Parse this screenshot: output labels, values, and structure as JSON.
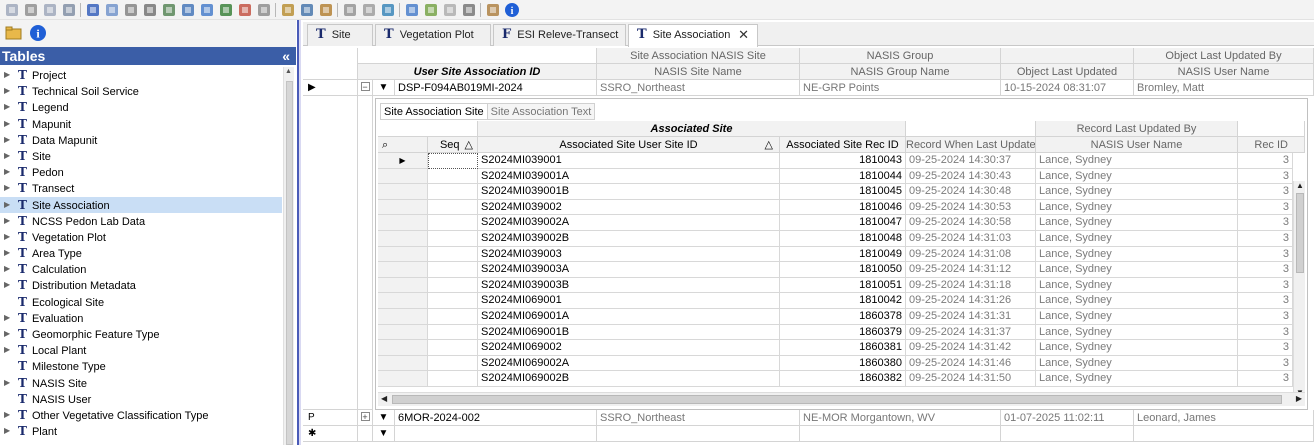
{
  "toolbar": {
    "buttons": [
      "copy-icon",
      "cut-icon",
      "paste-icon",
      "undo-icon",
      "grid-icon",
      "filter-icon",
      "tools-icon",
      "wizard-icon",
      "report-icon",
      "export-icon",
      "window-icon",
      "tree-icon",
      "gear-icon",
      "settings-icon",
      "db-icon",
      "edit-icon",
      "db2-icon",
      "shuffle-icon",
      "sort-icon",
      "refresh-icon",
      "upload-icon",
      "export2-icon",
      "calc-icon",
      "query-icon",
      "help-icon",
      "info-icon"
    ]
  },
  "left_panel": {
    "title": "Tables",
    "collapse_glyph": "«",
    "items": [
      {
        "label": "Project",
        "expandable": true
      },
      {
        "label": "Technical Soil Service",
        "expandable": true
      },
      {
        "label": "Legend",
        "expandable": true
      },
      {
        "label": "Mapunit",
        "expandable": true
      },
      {
        "label": "Data Mapunit",
        "expandable": true
      },
      {
        "label": "Site",
        "expandable": true
      },
      {
        "label": "Pedon",
        "expandable": true
      },
      {
        "label": "Transect",
        "expandable": true
      },
      {
        "label": "Site Association",
        "expandable": true,
        "selected": true
      },
      {
        "label": "NCSS Pedon Lab Data",
        "expandable": true
      },
      {
        "label": "Vegetation Plot",
        "expandable": true
      },
      {
        "label": "Area Type",
        "expandable": true
      },
      {
        "label": "Calculation",
        "expandable": true
      },
      {
        "label": "Distribution Metadata",
        "expandable": true
      },
      {
        "label": "Ecological Site",
        "expandable": false
      },
      {
        "label": "Evaluation",
        "expandable": true
      },
      {
        "label": "Geomorphic Feature Type",
        "expandable": true
      },
      {
        "label": "Local Plant",
        "expandable": true
      },
      {
        "label": "Milestone Type",
        "expandable": false
      },
      {
        "label": "NASIS Site",
        "expandable": true
      },
      {
        "label": "NASIS User",
        "expandable": false
      },
      {
        "label": "Other Vegetative Classification Type",
        "expandable": true
      },
      {
        "label": "Plant",
        "expandable": true
      }
    ]
  },
  "tabs": [
    {
      "icon": "T",
      "label": "Site",
      "active": false
    },
    {
      "icon": "T",
      "label": "Vegetation Plot",
      "active": false
    },
    {
      "icon": "F",
      "label": "ESI Releve-Transect",
      "active": false
    },
    {
      "icon": "T",
      "label": "Site Association",
      "active": true,
      "close": "✕"
    }
  ],
  "outer_grid": {
    "header_row1": [
      "Site Association NASIS Site",
      "NASIS Group",
      "",
      "Object Last Updated By"
    ],
    "header_row2": [
      "User Site Association ID",
      "NASIS Site Name",
      "NASIS Group Name",
      "Object Last Updated",
      "NASIS User Name"
    ],
    "rows": [
      {
        "marker": "▶",
        "expander": "−",
        "caret": "▼",
        "id": "DSP-F094AB019MI-2024",
        "site_name": "SSRO_Northeast",
        "group_name": "NE-GRP Points",
        "last_updated": "10-15-2024 08:31:07",
        "user": "Bromley, Matt"
      },
      {
        "marker": "P",
        "expander": "+",
        "caret": "▼",
        "id": "6MOR-2024-002",
        "site_name": "SSRO_Northeast",
        "group_name": "NE-MOR Morgantown, WV",
        "last_updated": "01-07-2025 11:02:11",
        "user": "Leonard, James"
      },
      {
        "marker": "✱",
        "expander": "",
        "caret": "▼",
        "id": "",
        "site_name": "",
        "group_name": "",
        "last_updated": "",
        "user": ""
      }
    ]
  },
  "sub_panel": {
    "tabs": [
      "Site Association Site",
      "Site Association Text"
    ],
    "group_header": "Associated Site",
    "group_header2": "Record Last Updated By",
    "columns": [
      "Seq",
      "Associated Site User Site ID",
      "Associated Site Rec ID",
      "Record When Last Updated",
      "NASIS User Name",
      "Rec ID"
    ],
    "search_glyph": "⌕",
    "sort_glyph": "△",
    "rows": [
      {
        "site": "S2024MI039001",
        "rec": "1810043",
        "when": "09-25-2024 14:30:37",
        "user": "Lance, Sydney",
        "rid": "3"
      },
      {
        "site": "S2024MI039001A",
        "rec": "1810044",
        "when": "09-25-2024 14:30:43",
        "user": "Lance, Sydney",
        "rid": "3"
      },
      {
        "site": "S2024MI039001B",
        "rec": "1810045",
        "when": "09-25-2024 14:30:48",
        "user": "Lance, Sydney",
        "rid": "3"
      },
      {
        "site": "S2024MI039002",
        "rec": "1810046",
        "when": "09-25-2024 14:30:53",
        "user": "Lance, Sydney",
        "rid": "3"
      },
      {
        "site": "S2024MI039002A",
        "rec": "1810047",
        "when": "09-25-2024 14:30:58",
        "user": "Lance, Sydney",
        "rid": "3"
      },
      {
        "site": "S2024MI039002B",
        "rec": "1810048",
        "when": "09-25-2024 14:31:03",
        "user": "Lance, Sydney",
        "rid": "3"
      },
      {
        "site": "S2024MI039003",
        "rec": "1810049",
        "when": "09-25-2024 14:31:08",
        "user": "Lance, Sydney",
        "rid": "3"
      },
      {
        "site": "S2024MI039003A",
        "rec": "1810050",
        "when": "09-25-2024 14:31:12",
        "user": "Lance, Sydney",
        "rid": "3"
      },
      {
        "site": "S2024MI039003B",
        "rec": "1810051",
        "when": "09-25-2024 14:31:18",
        "user": "Lance, Sydney",
        "rid": "3"
      },
      {
        "site": "S2024MI069001",
        "rec": "1810042",
        "when": "09-25-2024 14:31:26",
        "user": "Lance, Sydney",
        "rid": "3"
      },
      {
        "site": "S2024MI069001A",
        "rec": "1860378",
        "when": "09-25-2024 14:31:31",
        "user": "Lance, Sydney",
        "rid": "3"
      },
      {
        "site": "S2024MI069001B",
        "rec": "1860379",
        "when": "09-25-2024 14:31:37",
        "user": "Lance, Sydney",
        "rid": "3"
      },
      {
        "site": "S2024MI069002",
        "rec": "1860381",
        "when": "09-25-2024 14:31:42",
        "user": "Lance, Sydney",
        "rid": "3"
      },
      {
        "site": "S2024MI069002A",
        "rec": "1860380",
        "when": "09-25-2024 14:31:46",
        "user": "Lance, Sydney",
        "rid": "3"
      },
      {
        "site": "S2024MI069002B",
        "rec": "1860382",
        "when": "09-25-2024 14:31:50",
        "user": "Lance, Sydney",
        "rid": "3"
      }
    ]
  },
  "colors": {
    "tables_header": "#3b5ea7",
    "selected_row": "#c9def5",
    "icon_blue": "#1a2a6c"
  }
}
